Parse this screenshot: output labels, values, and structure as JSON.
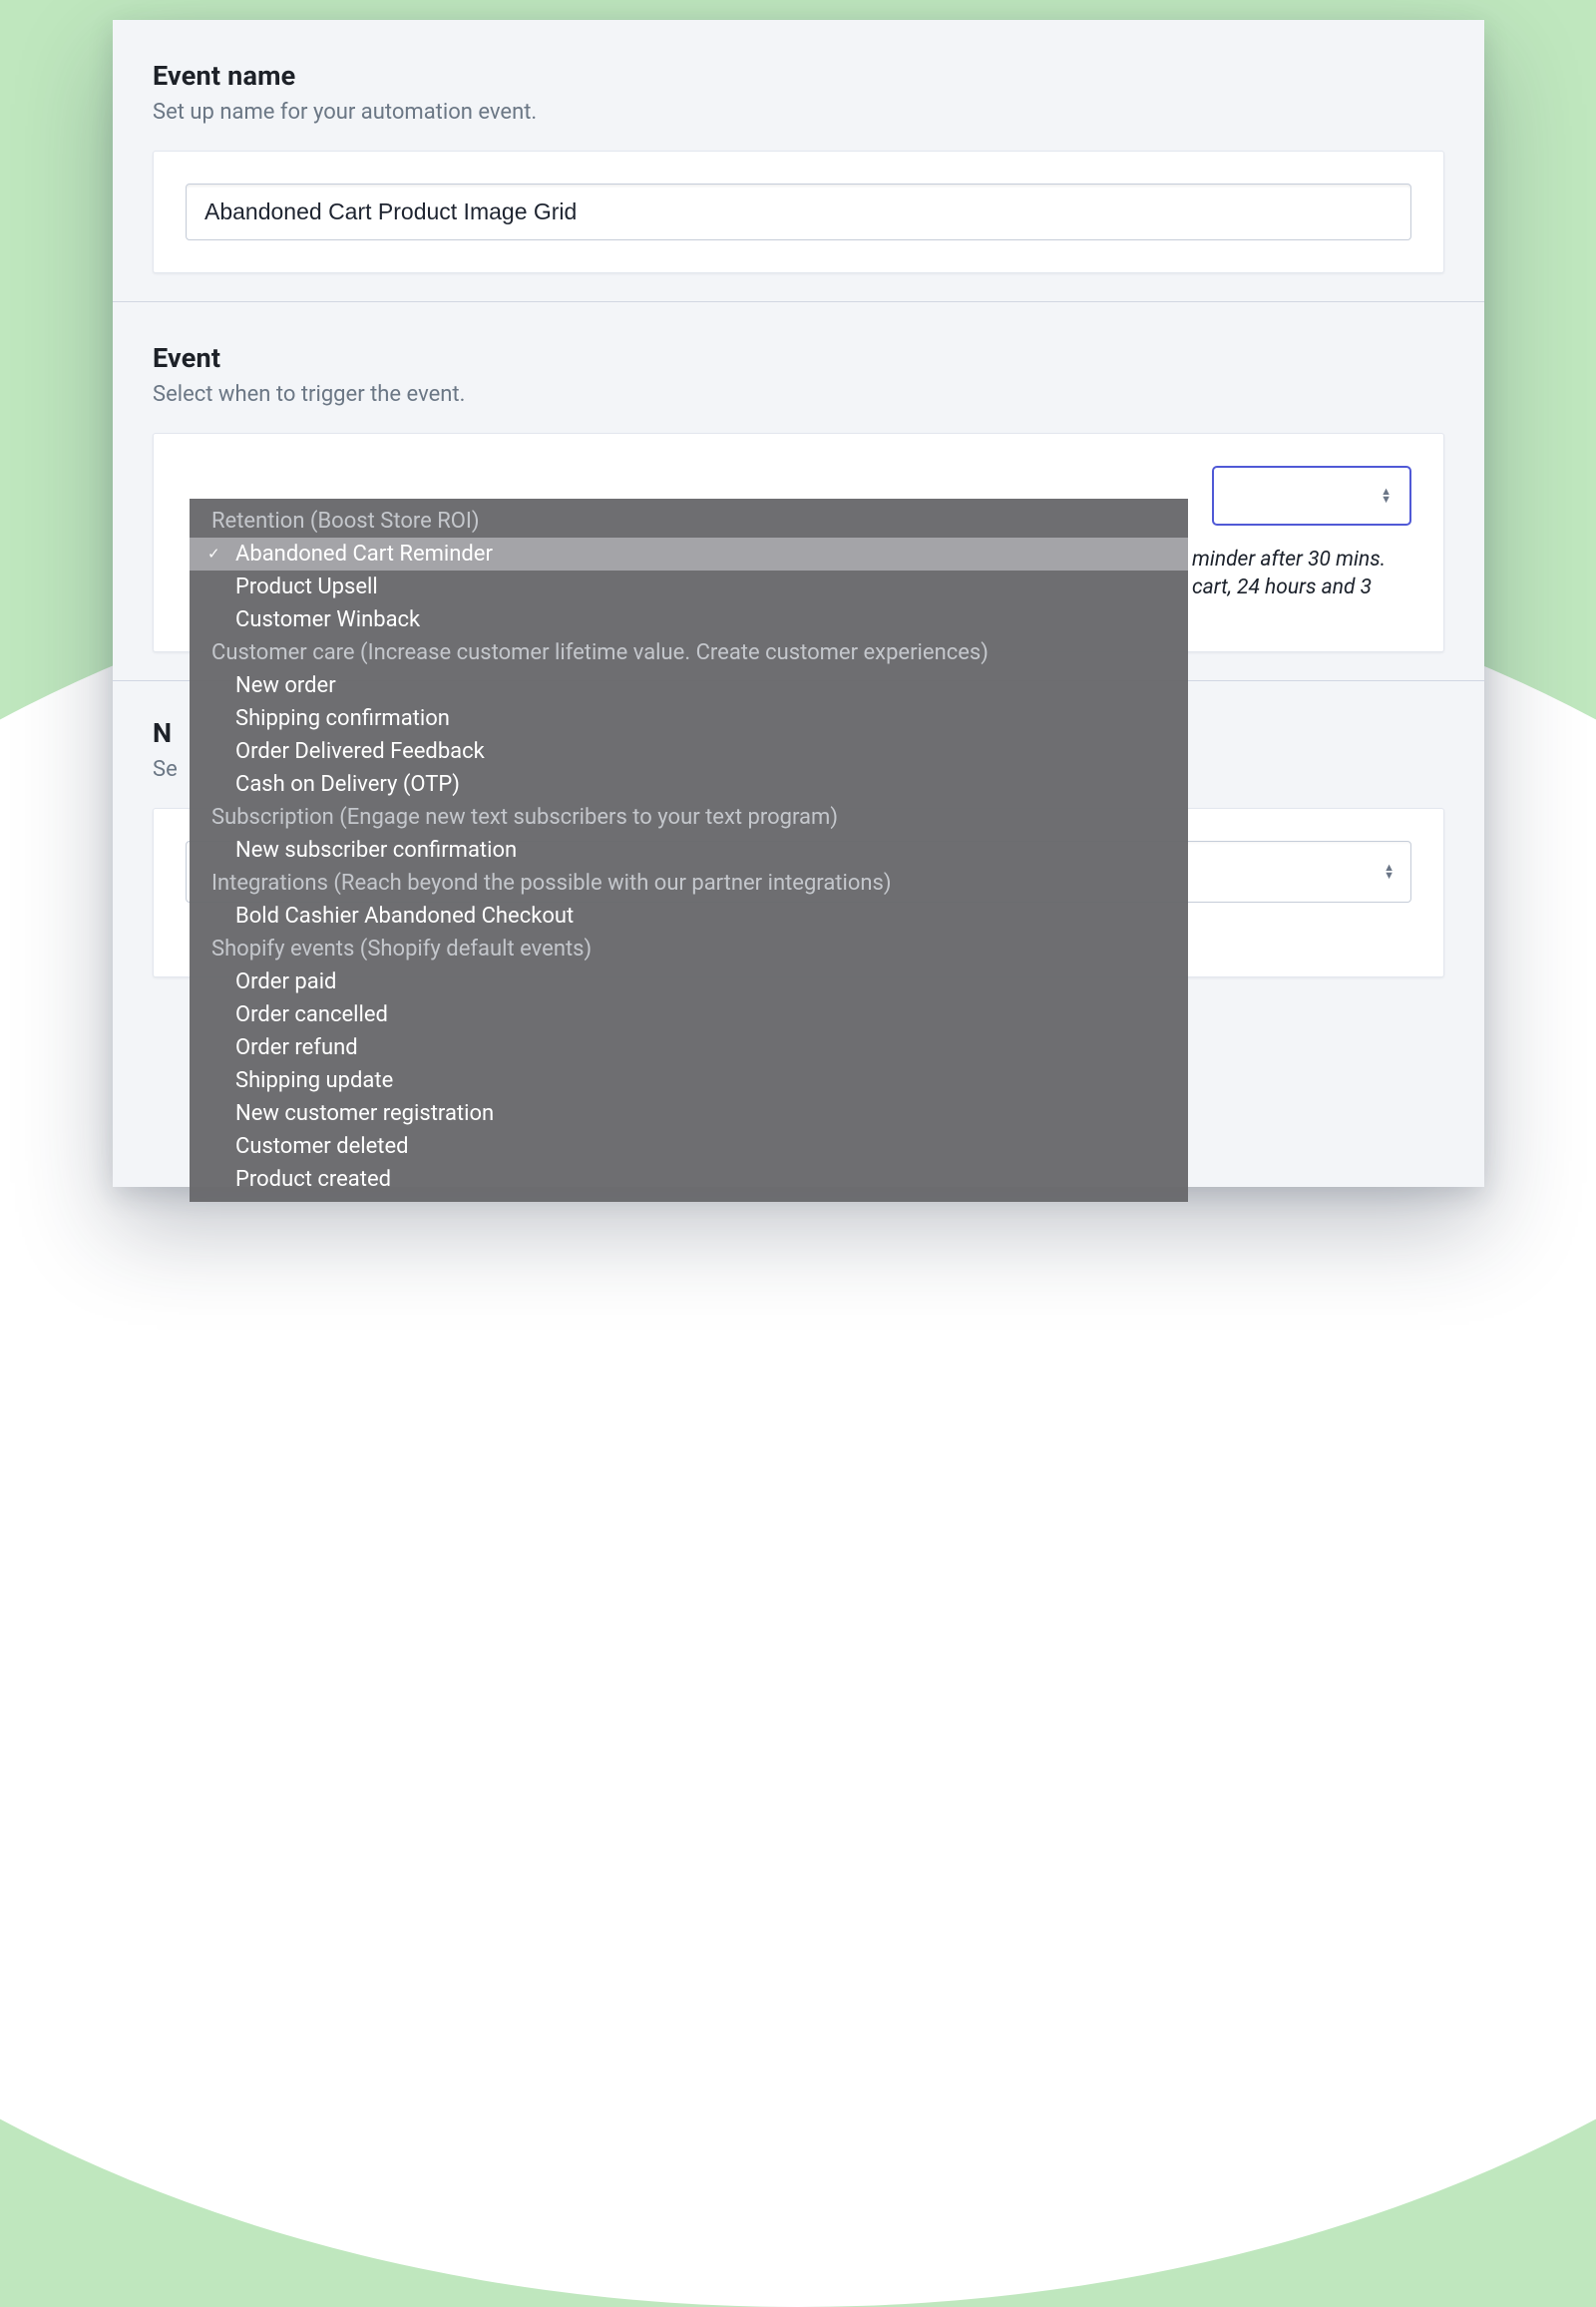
{
  "sections": {
    "event_name": {
      "title": "Event name",
      "subtitle": "Set up name for your automation event.",
      "value": "Abandoned Cart Product Image Grid"
    },
    "event": {
      "title": "Event",
      "subtitle": "Select when to trigger the event.",
      "description_lines": [
        "minder after 30 mins.",
        "cart, 24 hours and 3"
      ]
    },
    "third": {
      "title_prefix": "N",
      "subtitle_prefix": "Se"
    }
  },
  "dropdown": {
    "groups": [
      {
        "label": "Retention (Boost Store ROI)",
        "items": [
          {
            "label": "Abandoned Cart Reminder",
            "selected": true
          },
          {
            "label": "Product Upsell"
          },
          {
            "label": "Customer Winback"
          }
        ]
      },
      {
        "label": "Customer care (Increase customer lifetime value. Create customer experiences)",
        "items": [
          {
            "label": "New order"
          },
          {
            "label": "Shipping confirmation"
          },
          {
            "label": "Order Delivered Feedback"
          },
          {
            "label": "Cash on Delivery (OTP)"
          }
        ]
      },
      {
        "label": "Subscription (Engage new text subscribers to your text program)",
        "items": [
          {
            "label": "New subscriber confirmation"
          }
        ]
      },
      {
        "label": "Integrations (Reach beyond the possible with our partner integrations)",
        "items": [
          {
            "label": "Bold Cashier Abandoned Checkout"
          }
        ]
      },
      {
        "label": "Shopify events (Shopify default events)",
        "items": [
          {
            "label": "Order paid"
          },
          {
            "label": "Order cancelled"
          },
          {
            "label": "Order refund"
          },
          {
            "label": "Shipping update"
          },
          {
            "label": "New customer registration"
          },
          {
            "label": "Customer deleted"
          },
          {
            "label": "Product created"
          }
        ]
      }
    ]
  }
}
